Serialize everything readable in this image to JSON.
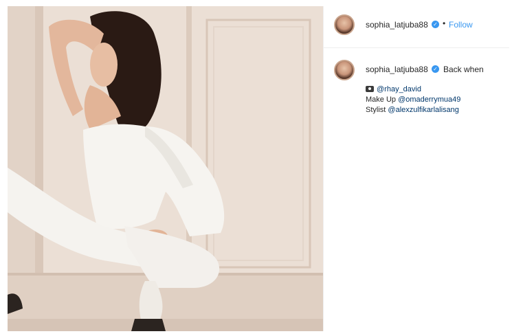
{
  "post": {
    "photo_alt": "Woman in white outfit crouching by a window"
  },
  "header": {
    "username": "sophia_latjuba88",
    "verified_symbol": "✓",
    "separator": "•",
    "follow_label": "Follow"
  },
  "caption": {
    "username": "sophia_latjuba88",
    "verified_symbol": "✓",
    "intro": "Back when",
    "lines": [
      {
        "prefix": "",
        "mention": "@rhay_david",
        "icon": "camera-icon"
      },
      {
        "prefix": "Make Up ",
        "mention": "@omaderrymua49"
      },
      {
        "prefix": "Stylist ",
        "mention": "@alexzulfikarlalisang"
      }
    ]
  },
  "colors": {
    "accent": "#3897f0",
    "mention": "#00376b",
    "text": "#262626",
    "divider": "#efefef"
  }
}
